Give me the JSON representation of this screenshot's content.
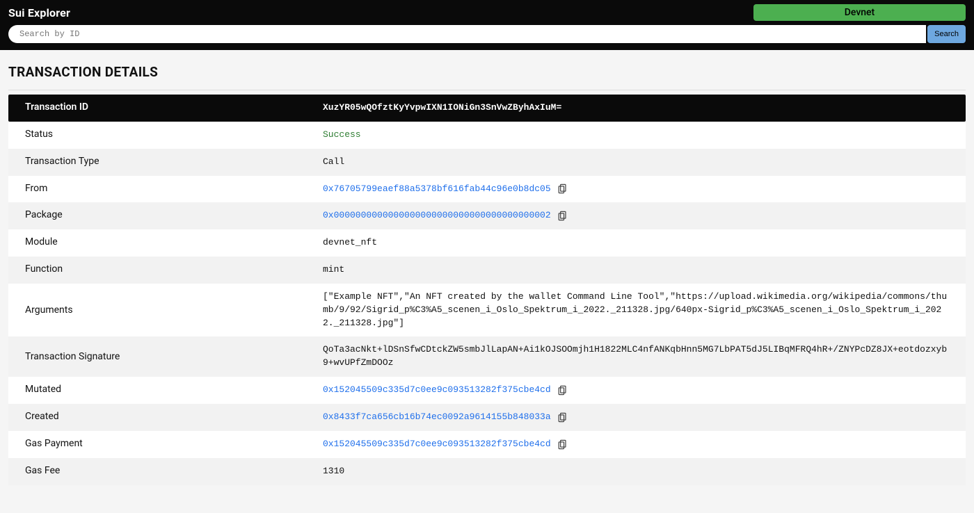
{
  "header": {
    "logo": "Sui Explorer",
    "network": "Devnet",
    "search_placeholder": "Search by ID",
    "search_button": "Search"
  },
  "page_title": "TRANSACTION DETAILS",
  "rows": {
    "tx_id": {
      "label": "Transaction ID",
      "value": "XuzYR05wQOfztKyYvpwIXN1IONiGn3SnVwZByhAxIuM="
    },
    "status": {
      "label": "Status",
      "value": "Success"
    },
    "tx_type": {
      "label": "Transaction Type",
      "value": "Call"
    },
    "from": {
      "label": "From",
      "value": "0x76705799eaef88a5378bf616fab44c96e0b8dc05"
    },
    "package": {
      "label": "Package",
      "value": "0x0000000000000000000000000000000000000002"
    },
    "module": {
      "label": "Module",
      "value": "devnet_nft"
    },
    "function": {
      "label": "Function",
      "value": "mint"
    },
    "arguments": {
      "label": "Arguments",
      "value": "[\"Example NFT\",\"An NFT created by the wallet Command Line Tool\",\"https://upload.wikimedia.org/wikipedia/commons/thumb/9/92/Sigrid_p%C3%A5_scenen_i_Oslo_Spektrum_i_2022._211328.jpg/640px-Sigrid_p%C3%A5_scenen_i_Oslo_Spektrum_i_2022._211328.jpg\"]"
    },
    "signature": {
      "label": "Transaction Signature",
      "value": "QoTa3acNkt+lDSnSfwCDtckZW5smbJlLapAN+Ai1kOJSOOmjh1H1822MLC4nfANKqbHnn5MG7LbPAT5dJ5LIBqMFRQ4hR+/ZNYPcDZ8JX+eotdozxyb9+wvUPfZmDOOz"
    },
    "mutated": {
      "label": "Mutated",
      "value": "0x152045509c335d7c0ee9c093513282f375cbe4cd"
    },
    "created": {
      "label": "Created",
      "value": "0x8433f7ca656cb16b74ec0092a9614155b848033a"
    },
    "gas_payment": {
      "label": "Gas Payment",
      "value": "0x152045509c335d7c0ee9c093513282f375cbe4cd"
    },
    "gas_fee": {
      "label": "Gas Fee",
      "value": "1310"
    }
  }
}
